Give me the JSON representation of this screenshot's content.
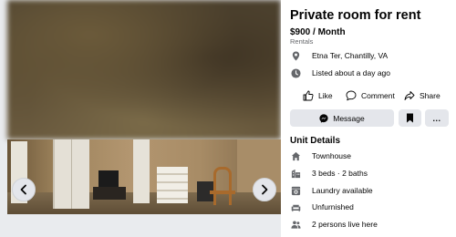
{
  "listing": {
    "title": "Private room for rent",
    "price": "$900 / Month",
    "category": "Rentals",
    "location": "Etna Ter, Chantilly, VA",
    "listed": "Listed about a day ago"
  },
  "actions": {
    "like": "Like",
    "comment": "Comment",
    "share": "Share"
  },
  "buttons": {
    "message": "Message",
    "more": "..."
  },
  "unit_details": {
    "heading": "Unit Details",
    "items": [
      {
        "icon": "home-icon",
        "label": "Townhouse"
      },
      {
        "icon": "building-icon",
        "label": "3 beds · 2 baths"
      },
      {
        "icon": "washer-icon",
        "label": "Laundry available"
      },
      {
        "icon": "sofa-icon",
        "label": "Unfurnished"
      },
      {
        "icon": "people-icon",
        "label": "2 persons live here"
      }
    ]
  },
  "gallery": {
    "icons": [
      "chevron-left-icon",
      "chevron-right-icon"
    ]
  },
  "colors": {
    "button_bg": "#e4e6eb",
    "text_primary": "#050505",
    "text_secondary": "#65676b",
    "icon_gray": "#65676b"
  }
}
